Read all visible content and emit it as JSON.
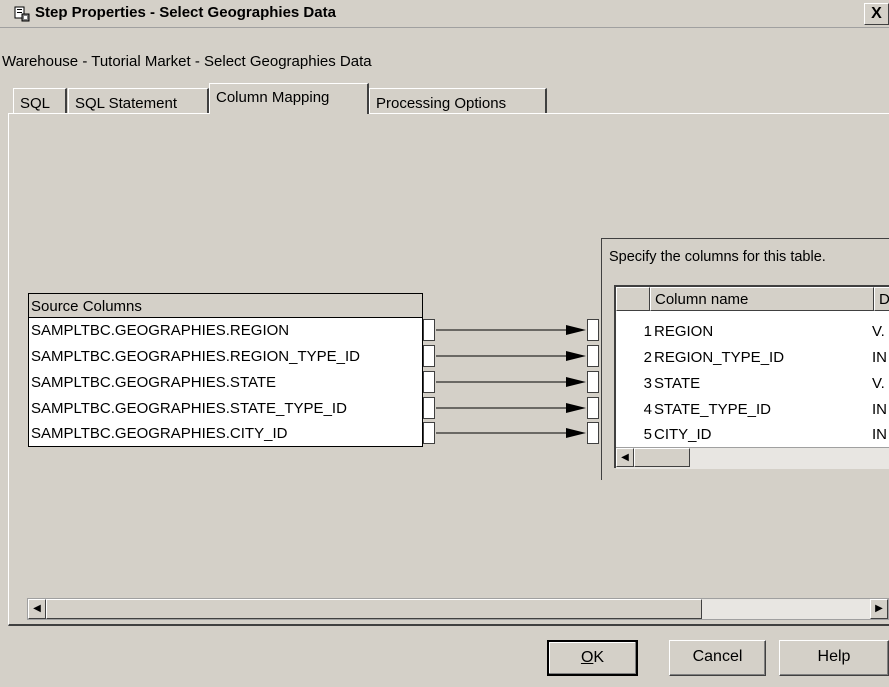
{
  "window": {
    "title": "Step Properties - Select Geographies Data",
    "icon": "step-properties-icon",
    "close_label": "X"
  },
  "subtitle": "Warehouse - Tutorial Market - Select Geographies Data",
  "tabs": [
    {
      "label": "SQL",
      "active": false
    },
    {
      "label": "SQL Statement",
      "active": false
    },
    {
      "label": "Column Mapping",
      "active": true
    },
    {
      "label": "Processing Options",
      "active": false
    }
  ],
  "source": {
    "header": "Source Columns",
    "columns": [
      "SAMPLTBC.GEOGRAPHIES.REGION",
      "SAMPLTBC.GEOGRAPHIES.REGION_TYPE_ID",
      "SAMPLTBC.GEOGRAPHIES.STATE",
      "SAMPLTBC.GEOGRAPHIES.STATE_TYPE_ID",
      "SAMPLTBC.GEOGRAPHIES.CITY_ID"
    ]
  },
  "target": {
    "caption": "Specify the columns for this table.",
    "headers": {
      "name": "Column name",
      "type": "D"
    },
    "rows": [
      {
        "num": "1",
        "name": "REGION",
        "type": "V."
      },
      {
        "num": "2",
        "name": "REGION_TYPE_ID",
        "type": "IN"
      },
      {
        "num": "3",
        "name": "STATE",
        "type": "V."
      },
      {
        "num": "4",
        "name": "STATE_TYPE_ID",
        "type": "IN"
      },
      {
        "num": "5",
        "name": "CITY_ID",
        "type": "IN"
      }
    ]
  },
  "buttons": {
    "ok_mnemonic": "O",
    "ok_rest": "K",
    "cancel": "Cancel",
    "help": "Help"
  },
  "colors": {
    "face": "#d4d0c8",
    "shadow": "#404040",
    "highlight": "#ffffff"
  }
}
